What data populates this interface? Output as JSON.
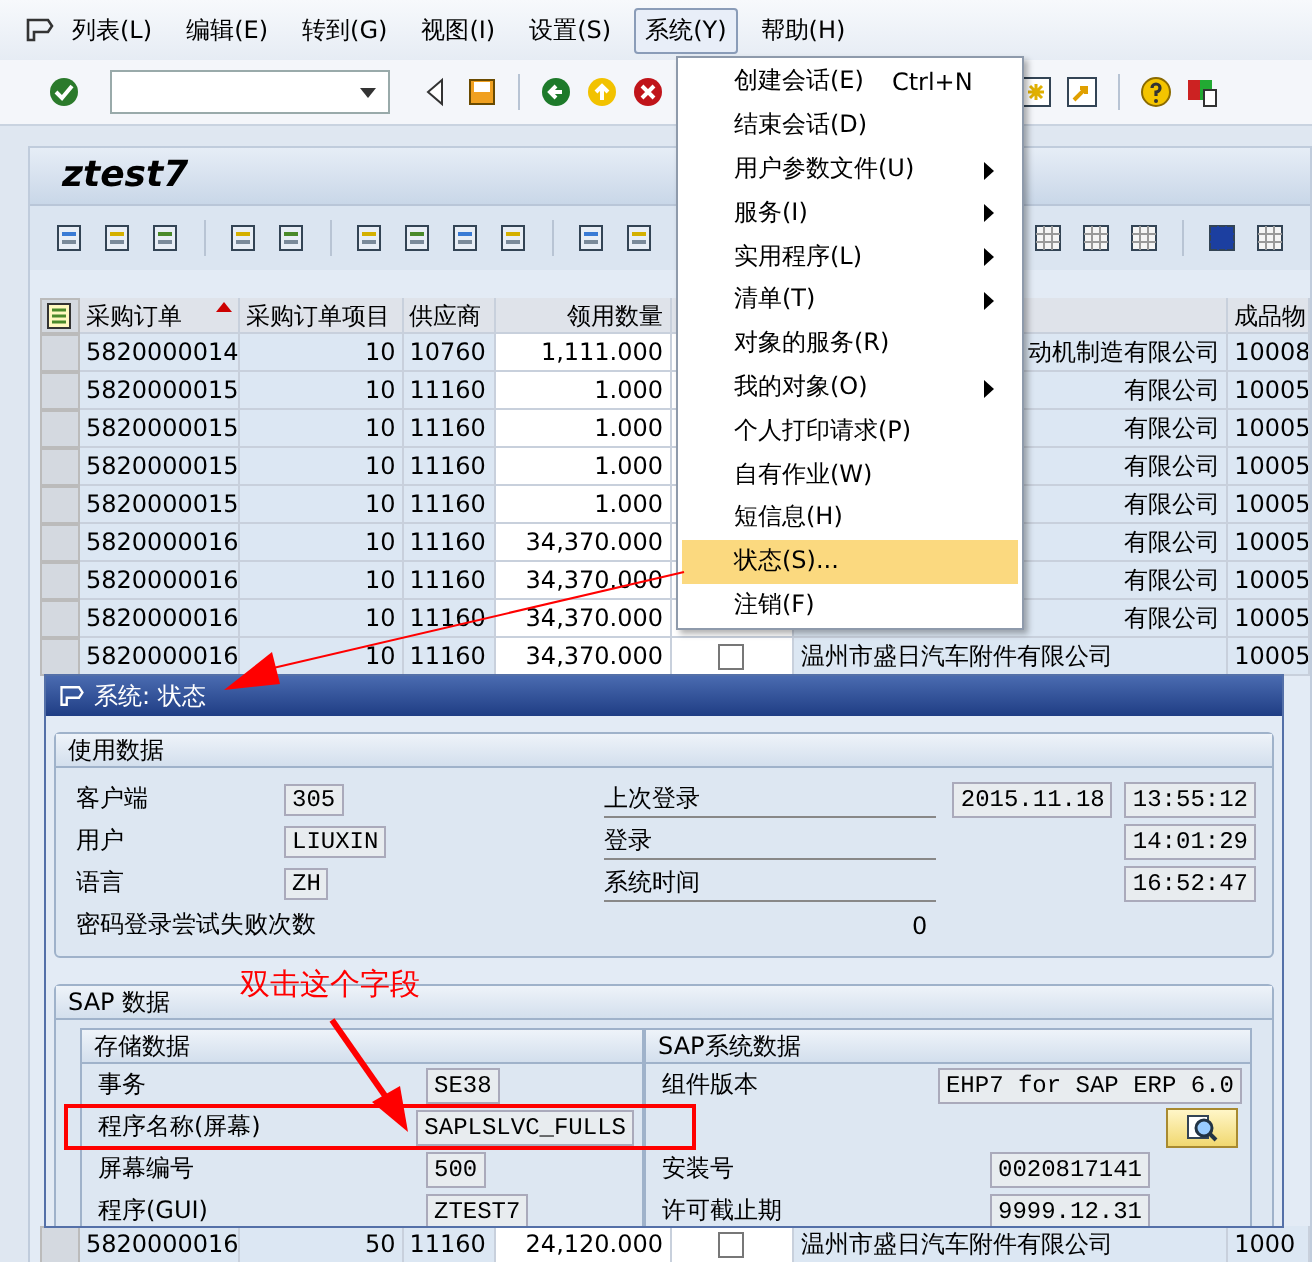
{
  "menubar": [
    {
      "label": "列表(L)",
      "selected": false
    },
    {
      "label": "编辑(E)",
      "selected": false
    },
    {
      "label": "转到(G)",
      "selected": false
    },
    {
      "label": "视图(I)",
      "selected": false
    },
    {
      "label": "设置(S)",
      "selected": false
    },
    {
      "label": "系统(Y)",
      "selected": true
    },
    {
      "label": "帮助(H)",
      "selected": false
    }
  ],
  "title": "ztest7",
  "table": {
    "columns": [
      {
        "label": "采购订单",
        "sorted": true
      },
      {
        "label": "采购订单项目",
        "sorted": false
      },
      {
        "label": "供应商",
        "sorted": false
      },
      {
        "label": "领用数量",
        "sorted": false
      },
      {
        "label": "成品物",
        "sorted": false
      }
    ],
    "rows": [
      {
        "po": "5820000014",
        "item": "10",
        "vendor": "10760",
        "qty": "1,111.000",
        "name": "动机制造有限公司",
        "material": "10008"
      },
      {
        "po": "5820000015",
        "item": "10",
        "vendor": "11160",
        "qty": "1.000",
        "name": "有限公司",
        "material": "10005"
      },
      {
        "po": "5820000015",
        "item": "10",
        "vendor": "11160",
        "qty": "1.000",
        "name": "有限公司",
        "material": "10005"
      },
      {
        "po": "5820000015",
        "item": "10",
        "vendor": "11160",
        "qty": "1.000",
        "name": "有限公司",
        "material": "10005"
      },
      {
        "po": "5820000015",
        "item": "10",
        "vendor": "11160",
        "qty": "1.000",
        "name": "有限公司",
        "material": "10005"
      },
      {
        "po": "5820000016",
        "item": "10",
        "vendor": "11160",
        "qty": "34,370.000",
        "name": "有限公司",
        "material": "10005"
      },
      {
        "po": "5820000016",
        "item": "10",
        "vendor": "11160",
        "qty": "34,370.000",
        "name": "有限公司",
        "material": "10005"
      },
      {
        "po": "5820000016",
        "item": "10",
        "vendor": "11160",
        "qty": "34,370.000",
        "name": "有限公司",
        "material": "10005"
      },
      {
        "po": "5820000016",
        "item": "10",
        "vendor": "11160",
        "qty": "34,370.000",
        "checked": false,
        "name": "温州市盛日汽车附件有限公司",
        "material": "10005"
      }
    ],
    "bottom_row": {
      "po": "5820000016",
      "item": "50",
      "vendor": "11160",
      "qty": "24,120.000",
      "checked": false,
      "name": "温州市盛日汽车附件有限公司",
      "material": "1000"
    }
  },
  "menu": {
    "items": [
      {
        "label": "创建会话(E)",
        "shortcut": "Ctrl+N",
        "submenu": false,
        "selected": false
      },
      {
        "label": "结束会话(D)",
        "submenu": false,
        "selected": false
      },
      {
        "label": "用户参数文件(U)",
        "submenu": true,
        "selected": false
      },
      {
        "label": "服务(I)",
        "submenu": true,
        "selected": false
      },
      {
        "label": "实用程序(L)",
        "submenu": true,
        "selected": false
      },
      {
        "label": "清单(T)",
        "submenu": true,
        "selected": false
      },
      {
        "label": "对象的服务(R)",
        "submenu": false,
        "selected": false
      },
      {
        "label": "我的对象(O)",
        "submenu": true,
        "selected": false
      },
      {
        "label": "个人打印请求(P)",
        "submenu": false,
        "selected": false
      },
      {
        "label": "自有作业(W)",
        "submenu": false,
        "selected": false
      },
      {
        "label": "短信息(H)",
        "submenu": false,
        "selected": false
      },
      {
        "label": "状态(S)...",
        "submenu": false,
        "selected": true
      },
      {
        "label": "注销(F)",
        "submenu": false,
        "selected": false
      }
    ]
  },
  "dialog": {
    "title": "系统: 状态",
    "usage": {
      "title": "使用数据",
      "rows": [
        {
          "label": "客户端",
          "value": "305",
          "right_label": "上次登录",
          "right_values": [
            "2015.11.18",
            "13:55:12"
          ]
        },
        {
          "label": "用户",
          "value": "LIUXIN",
          "right_label": "登录",
          "right_values": [
            "14:01:29"
          ]
        },
        {
          "label": "语言",
          "value": "ZH",
          "right_label": "系统时间",
          "right_values": [
            "16:52:47"
          ]
        },
        {
          "label": "密码登录尝试失败次数",
          "count": "0"
        }
      ]
    },
    "sap": {
      "title": "SAP 数据",
      "left": {
        "title": "存储数据",
        "rows": [
          {
            "label": "事务",
            "value": "SE38",
            "highlighted": false
          },
          {
            "label": "程序名称(屏幕)",
            "value": "SAPLSLVC_FULLS",
            "highlighted": true
          },
          {
            "label": "屏幕编号",
            "value": "500",
            "highlighted": false
          },
          {
            "label": "程序(GUI)",
            "value": "ZTEST7",
            "highlighted": false
          }
        ]
      },
      "right": {
        "title": "SAP系统数据",
        "rows": [
          {
            "kind": "field",
            "label": "组件版本",
            "value": "EHP7 for SAP ERP 6.0"
          },
          {
            "kind": "button"
          },
          {
            "kind": "field",
            "label": "安装号",
            "value": "0020817141"
          },
          {
            "kind": "field",
            "label": "许可截止期",
            "value": "9999.12.31"
          }
        ]
      }
    }
  },
  "note": "双击这个字段"
}
